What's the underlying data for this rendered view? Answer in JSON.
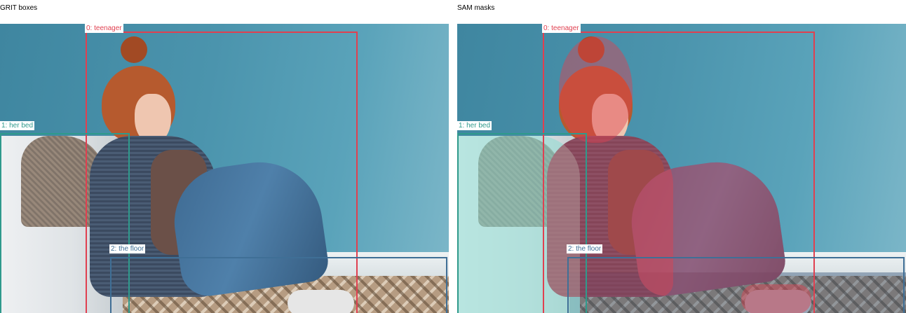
{
  "panels": {
    "left_title": "GRIT boxes",
    "right_title": "SAM masks"
  },
  "labels": {
    "teenager": "0: teenager",
    "bed": "1: her bed",
    "floor": "2: the floor"
  },
  "colors": {
    "teenager": "#e04050",
    "bed": "#2f9a8c",
    "floor": "#3f6f96",
    "teenager_mask": "rgba(224,64,80,0.45)",
    "bed_mask": "rgba(140,220,210,0.55)",
    "floor_mask": "rgba(35,70,110,0.4)"
  }
}
